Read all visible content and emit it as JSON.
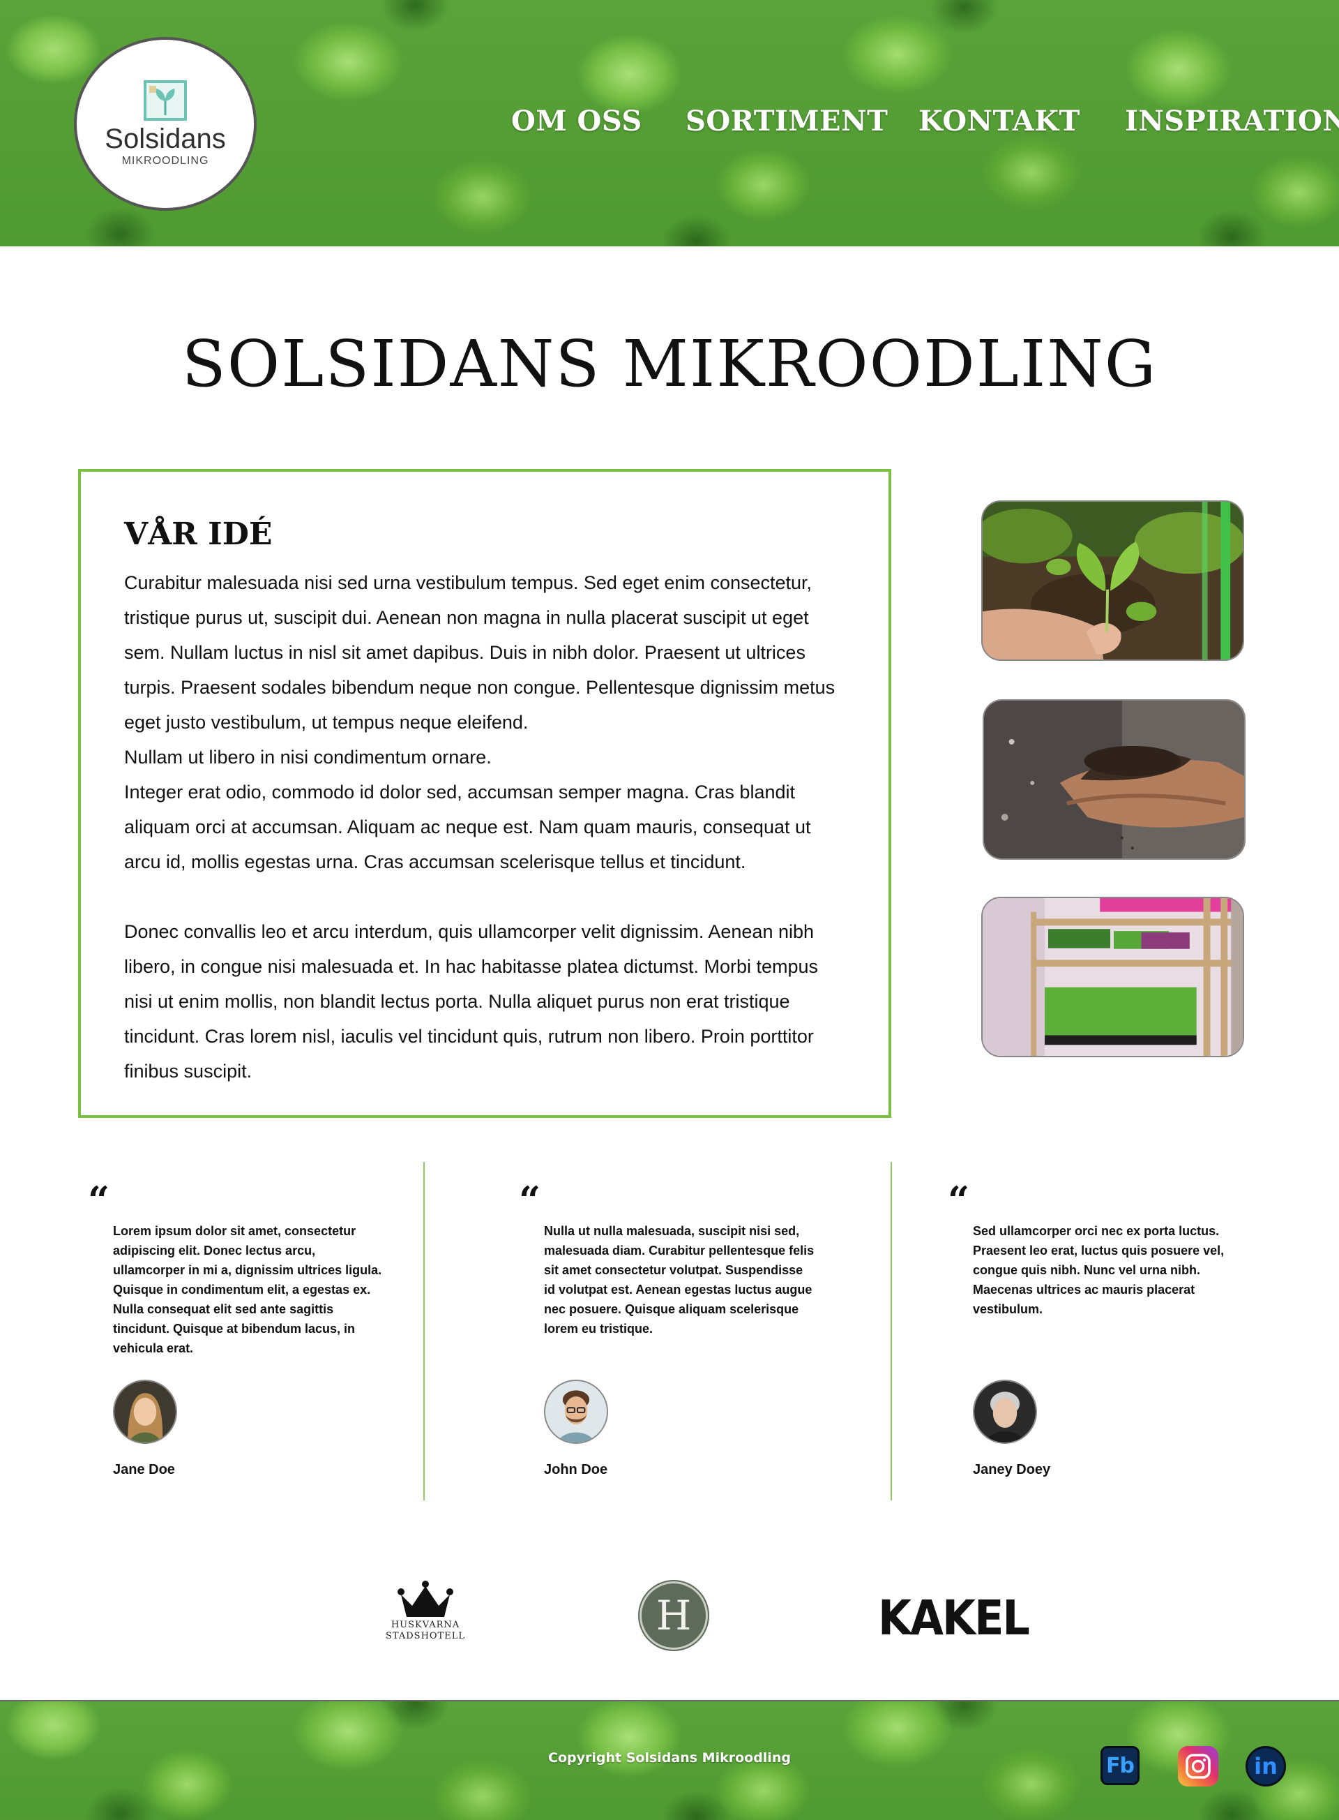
{
  "logo": {
    "name": "Solsidans",
    "subtitle": "MIKROODLING"
  },
  "nav": {
    "items": [
      "OM OSS",
      "SORTIMENT",
      "KONTAKT",
      "INSPIRATION"
    ]
  },
  "page_title": "SOLSIDANS MIKROODLING",
  "idea": {
    "title": "VÅR IDÉ",
    "paragraphs": [
      "Curabitur malesuada nisi sed urna vestibulum tempus. Sed eget enim consectetur, tristique purus ut, suscipit dui. Aenean non magna in nulla placerat suscipit ut eget sem. Nullam luctus in nisl sit amet dapibus. Duis in nibh dolor. Praesent ut ultrices turpis. Praesent sodales bibendum neque non congue. Pellentesque dignissim metus eget justo vestibulum, ut tempus neque eleifend.",
      "Nullam ut libero in nisi condimentum ornare.",
      "Integer erat odio, commodo id dolor sed, accumsan semper magna. Cras blandit aliquam orci at accumsan. Aliquam ac neque est. Nam quam mauris, consequat ut arcu id, mollis egestas urna. Cras accumsan scelerisque tellus et tincidunt.",
      "Donec convallis leo et arcu interdum, quis ullamcorper velit dignissim. Aenean nibh libero, in congue nisi malesuada et. In hac habitasse platea dictumst. Morbi tempus nisi ut enim mollis, non blandit lectus porta. Nulla aliquet purus non erat tristique tincidunt. Cras lorem nisl, iaculis vel tincidunt quis, rutrum non libero. Proin porttitor finibus suscipit."
    ]
  },
  "photos": [
    "hand-seedling-photo",
    "soil-hands-photo",
    "grow-shelf-photo"
  ],
  "testimonials": [
    {
      "quote_mark": "“",
      "text": "Lorem ipsum dolor sit amet, consectetur adipiscing elit. Donec lectus arcu, ullamcorper in mi a, dignissim ultrices ligula. Quisque in condimentum elit, a egestas ex. Nulla consequat elit sed ante sagittis tincidunt. Quisque at bibendum lacus, in vehicula erat.",
      "name": "Jane Doe"
    },
    {
      "quote_mark": "“",
      "text": "Nulla ut nulla malesuada, suscipit nisi sed, malesuada diam. Curabitur pellentesque felis sit amet consectetur volutpat. Suspendisse id volutpat est. Aenean egestas luctus augue nec posuere. Quisque aliquam scelerisque lorem eu tristique.",
      "name": "John Doe"
    },
    {
      "quote_mark": "“",
      "text": "Sed ullamcorper orci nec ex porta luctus. Praesent leo erat, luctus quis posuere vel, congue quis nibh. Nunc vel urna nibh. Maecenas ultrices ac mauris placerat vestibulum.",
      "name": "Janey Doey"
    }
  ],
  "partners": {
    "huskvarna_line1": "HUSKVARNA",
    "huskvarna_line2": "STADSHOTELL",
    "h_letter": "H",
    "kakel": "KAKEL"
  },
  "footer": {
    "copyright": "Copyright Solsidans Mikroodling",
    "social": {
      "facebook": "Fb",
      "linkedin": "in"
    }
  },
  "colors": {
    "accent_green": "#7ac142",
    "divider_green": "#8ccd5e",
    "header_leaf": "#6fb844"
  }
}
